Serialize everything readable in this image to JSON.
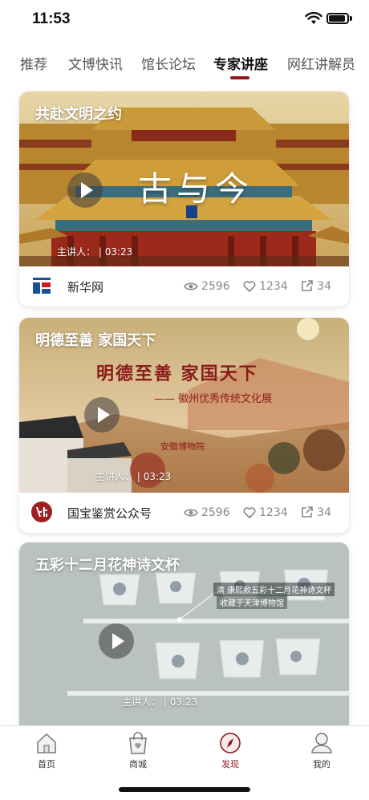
{
  "status_bar": {
    "time": "11:53"
  },
  "tabs": [
    {
      "label": "推荐",
      "active": false
    },
    {
      "label": "文博快讯",
      "active": false
    },
    {
      "label": "馆长论坛",
      "active": false
    },
    {
      "label": "专家讲座",
      "active": true
    },
    {
      "label": "网红讲解员",
      "active": false
    }
  ],
  "cards": [
    {
      "title": "共赴文明之约",
      "overlay_text": "古与今",
      "speaker_label": "主讲人：",
      "duration": "03:23",
      "source": "新华网",
      "views": "2596",
      "likes": "1234",
      "shares": "34"
    },
    {
      "title": "明德至善 家国天下",
      "overlay_text": "明德至善 家国天下",
      "overlay_sub": "—— 徽州优秀传统文化展",
      "overlay_museum": "安徽博物院",
      "speaker_label": "主讲人：",
      "duration": "03:23",
      "source": "国宝鉴赏公众号",
      "views": "2596",
      "likes": "1234",
      "shares": "34"
    },
    {
      "title": "五彩十二月花神诗文杯",
      "caption_1": "清 康熙款五彩十二月花神诗文杯",
      "caption_2": "收藏于天津博物馆",
      "speaker_label": "主讲人：",
      "duration": "03:23"
    }
  ],
  "tabbar": [
    {
      "label": "首页",
      "icon": "home-icon",
      "active": false
    },
    {
      "label": "商城",
      "icon": "shop-bag-icon",
      "active": false
    },
    {
      "label": "发现",
      "icon": "compass-icon",
      "active": true
    },
    {
      "label": "我的",
      "icon": "profile-icon",
      "active": false
    }
  ],
  "colors": {
    "accent": "#8b1a1a",
    "muted": "#888888"
  }
}
